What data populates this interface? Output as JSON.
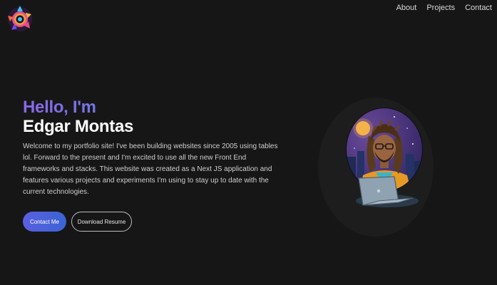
{
  "nav": {
    "items": [
      "About",
      "Projects",
      "Contact"
    ]
  },
  "hero": {
    "greeting": "Hello, I'm",
    "name": "Edgar Montas",
    "intro": "Welcome to my portfolio site! I've been building websites since 2005 using tables lol. Forward to the present and I'm excited to use all the new Front End frameworks and stacks. This website was created as a Next JS application and features various projects and experiments I'm using to stay up to date with the current technologies.",
    "primary_button": "Contact Me",
    "secondary_button": "Download Resume"
  },
  "colors": {
    "background": "#161616",
    "accent_start": "#8a67e6",
    "accent_end": "#4d92e6",
    "button_primary": "#4a62dc"
  },
  "icons": {
    "logo": "colorful-gear-logo",
    "avatar": "illustrated-developer-with-laptop"
  }
}
